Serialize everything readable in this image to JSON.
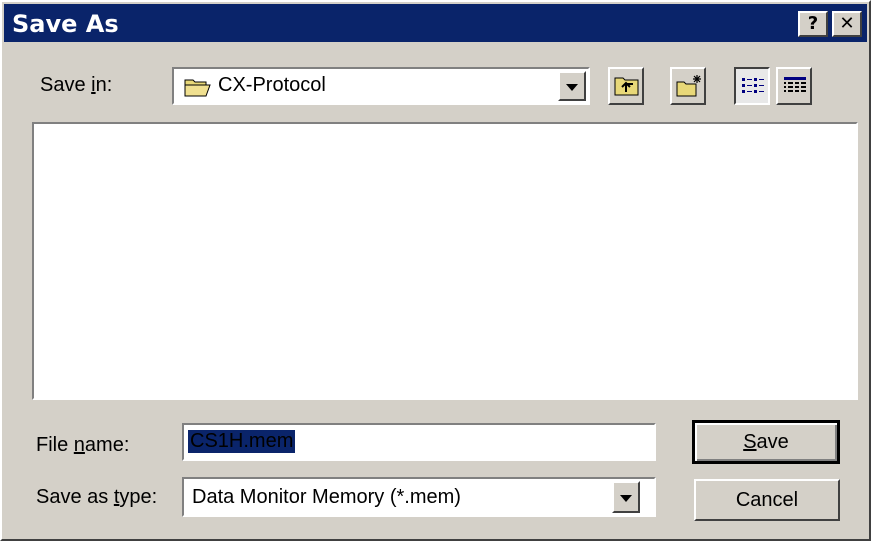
{
  "titlebar": {
    "title": "Save As",
    "help_label": "?",
    "close_label": "✕"
  },
  "save_in": {
    "label_pre": "Save ",
    "label_key": "i",
    "label_post": "n:",
    "value": "CX-Protocol",
    "icon": "folder-open-icon"
  },
  "toolbar": {
    "up_icon": "up-one-level-icon",
    "new_folder_icon": "new-folder-icon",
    "list_icon": "list-view-icon",
    "details_icon": "details-view-icon"
  },
  "file_list": {
    "items": []
  },
  "file_name": {
    "label_pre": "File ",
    "label_key": "n",
    "label_post": "ame:",
    "value": "CS1H.mem"
  },
  "save_as_type": {
    "label_pre": "Save as ",
    "label_key": "t",
    "label_post": "ype:",
    "value": "Data Monitor Memory (*.mem)"
  },
  "buttons": {
    "save_key": "S",
    "save_rest": "ave",
    "cancel": "Cancel"
  },
  "colors": {
    "titlebar": "#0a246a",
    "face": "#d4d0c8",
    "selection": "#0a246a"
  }
}
